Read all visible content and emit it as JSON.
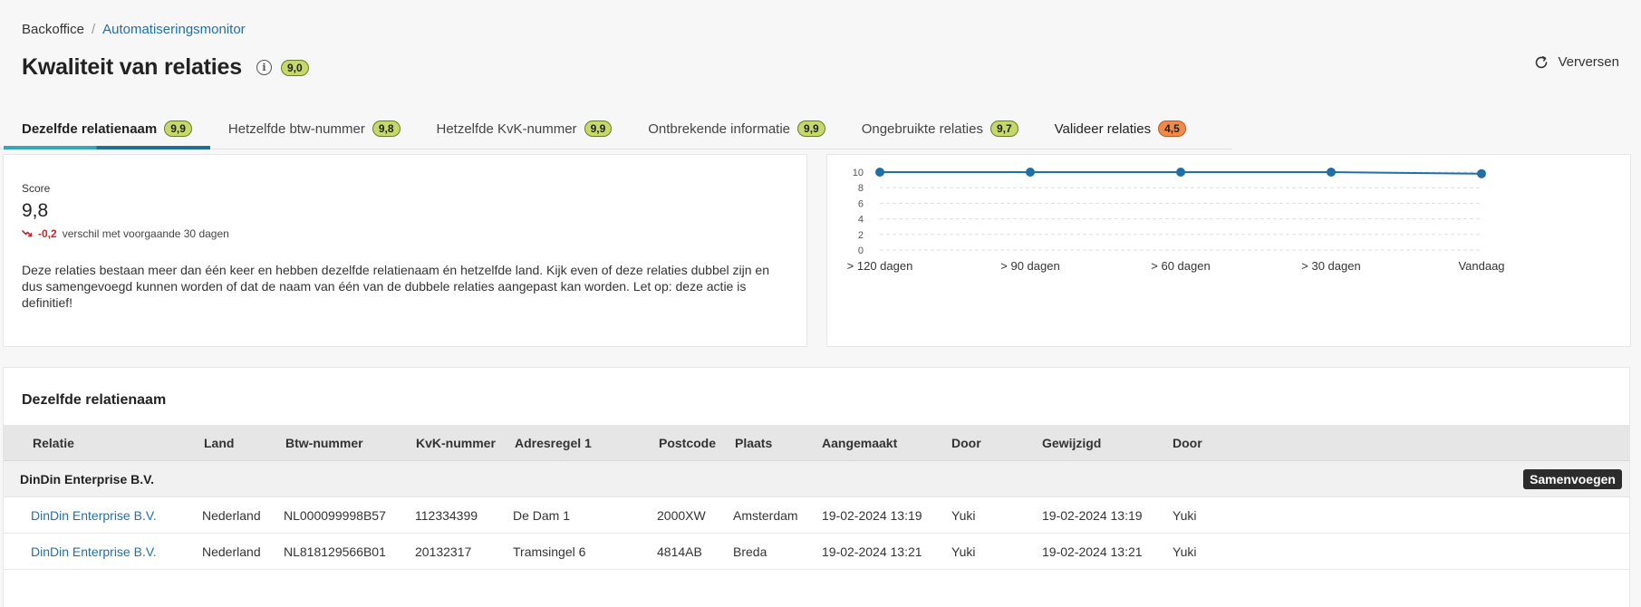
{
  "breadcrumb": {
    "root": "Backoffice",
    "separator": "/",
    "current": "Automatiseringsmonitor"
  },
  "header": {
    "title": "Kwaliteit van relaties",
    "score_badge": "9,0",
    "refresh_label": "Verversen"
  },
  "tabs": [
    {
      "label": "Dezelfde relatienaam",
      "badge": "9,9"
    },
    {
      "label": "Hetzelfde btw-nummer",
      "badge": "9,8"
    },
    {
      "label": "Hetzelfde KvK-nummer",
      "badge": "9,9"
    },
    {
      "label": "Ontbrekende informatie",
      "badge": "9,9"
    },
    {
      "label": "Ongebruikte relaties",
      "badge": "9,7"
    },
    {
      "label": "Valideer relaties",
      "badge": "4,5"
    }
  ],
  "score": {
    "label": "Score",
    "value": "9,8",
    "diff": "-0,2",
    "diff_text": "verschil met voorgaande 30 dagen",
    "description": "Deze relaties bestaan meer dan één keer en hebben dezelfde relatienaam én hetzelfde land. Kijk even of deze relaties dubbel zijn en dus samengevoegd kunnen worden of dat de naam van één van de dubbele relaties aangepast kan worden. Let op: deze actie is definitief!"
  },
  "chart_data": {
    "type": "line",
    "categories": [
      "> 120 dagen",
      "> 90 dagen",
      "> 60 dagen",
      "> 30 dagen",
      "Vandaag"
    ],
    "values": [
      10,
      10,
      10,
      10,
      9.8
    ],
    "ylim": [
      0,
      10
    ],
    "yticks": [
      "0",
      "2",
      "4",
      "6",
      "8",
      "10"
    ],
    "grid": true,
    "color": "#1f6fa8"
  },
  "table": {
    "title": "Dezelfde relatienaam",
    "columns": [
      "Relatie",
      "Land",
      "Btw-nummer",
      "KvK-nummer",
      "Adresregel 1",
      "Postcode",
      "Plaats",
      "Aangemaakt",
      "Door",
      "Gewijzigd",
      "Door"
    ],
    "group": {
      "name": "DinDin Enterprise B.V.",
      "action_label": "Samenvoegen"
    },
    "rows": [
      [
        "DinDin Enterprise B.V.",
        "Nederland",
        "NL000099998B57",
        "112334399",
        "De Dam 1",
        "2000XW",
        "Amsterdam",
        "19-02-2024 13:19",
        "Yuki",
        "19-02-2024 13:19",
        "Yuki"
      ],
      [
        "DinDin Enterprise B.V.",
        "Nederland",
        "NL818129566B01",
        "20132317",
        "Tramsingel 6",
        "4814AB",
        "Breda",
        "19-02-2024 13:21",
        "Yuki",
        "19-02-2024 13:21",
        "Yuki"
      ]
    ]
  }
}
